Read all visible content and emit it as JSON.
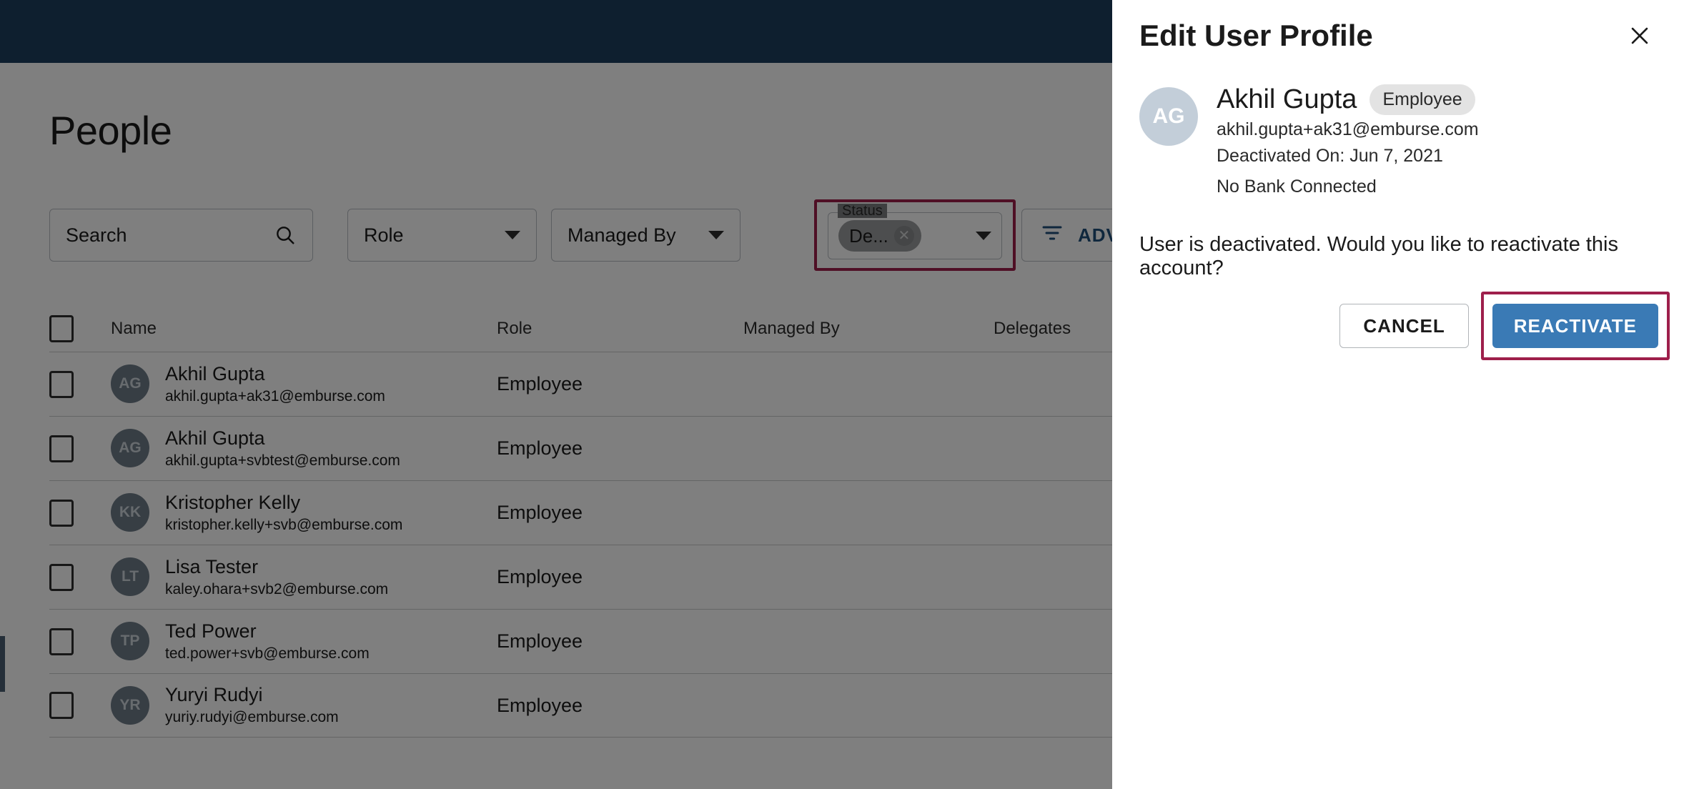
{
  "colors": {
    "topnav": "#1d3f5e",
    "highlight": "#9e1f4b",
    "primary_button": "#3a7ab5",
    "advanced_link": "#1f4f7a"
  },
  "page": {
    "title": "People"
  },
  "search": {
    "placeholder": "Search",
    "icon": "search-icon"
  },
  "filters": {
    "role": {
      "label": "Role",
      "caret": "chevron-down-icon"
    },
    "managed_by": {
      "label": "Managed By",
      "caret": "chevron-down-icon"
    },
    "status": {
      "legend": "Status",
      "chip_label": "De...",
      "chip_remove_icon": "close-circle-icon",
      "caret": "chevron-down-icon"
    },
    "advanced": {
      "label": "ADVANCED",
      "icon": "filter-icon"
    }
  },
  "table": {
    "columns": [
      "Name",
      "Role",
      "Managed By",
      "Delegates"
    ],
    "select_all_icon": "checkbox-icon",
    "rows": [
      {
        "initials": "AG",
        "name": "Akhil Gupta",
        "email": "akhil.gupta+ak31@emburse.com",
        "role": "Employee",
        "managed_by": "",
        "delegates": ""
      },
      {
        "initials": "AG",
        "name": "Akhil Gupta",
        "email": "akhil.gupta+svbtest@emburse.com",
        "role": "Employee",
        "managed_by": "",
        "delegates": ""
      },
      {
        "initials": "KK",
        "name": "Kristopher Kelly",
        "email": "kristopher.kelly+svb@emburse.com",
        "role": "Employee",
        "managed_by": "",
        "delegates": ""
      },
      {
        "initials": "LT",
        "name": "Lisa Tester",
        "email": "kaley.ohara+svb2@emburse.com",
        "role": "Employee",
        "managed_by": "",
        "delegates": ""
      },
      {
        "initials": "TP",
        "name": "Ted Power",
        "email": "ted.power+svb@emburse.com",
        "role": "Employee",
        "managed_by": "",
        "delegates": ""
      },
      {
        "initials": "YR",
        "name": "Yuryi Rudyi",
        "email": "yuriy.rudyi@emburse.com",
        "role": "Employee",
        "managed_by": "",
        "delegates": ""
      }
    ]
  },
  "drawer": {
    "title": "Edit User Profile",
    "close_icon": "close-icon",
    "user": {
      "initials": "AG",
      "name": "Akhil Gupta",
      "role_chip": "Employee",
      "email": "akhil.gupta+ak31@emburse.com",
      "deactivated_on": "Deactivated On: Jun 7, 2021",
      "bank_status": "No Bank Connected"
    },
    "message": "User is deactivated. Would you like to reactivate this account?",
    "cancel_label": "CANCEL",
    "reactivate_label": "REACTIVATE"
  }
}
